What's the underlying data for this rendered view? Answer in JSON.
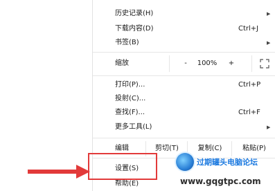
{
  "menu": {
    "items_top": [
      {
        "label": "历史记录(H)",
        "shortcut": "",
        "submenu": true
      },
      {
        "label": "下载内容(D)",
        "shortcut": "Ctrl+J",
        "submenu": false
      },
      {
        "label": "书签(B)",
        "shortcut": "",
        "submenu": true
      }
    ],
    "zoom": {
      "label": "缩放",
      "minus": "-",
      "value": "100%",
      "plus": "+",
      "fullscreen_icon": "fullscreen-icon"
    },
    "items_mid": [
      {
        "label": "打印(P)...",
        "shortcut": "Ctrl+P",
        "submenu": false
      },
      {
        "label": "投射(C)...",
        "shortcut": "",
        "submenu": false
      },
      {
        "label": "查找(F)...",
        "shortcut": "Ctrl+F",
        "submenu": false
      },
      {
        "label": "更多工具(L)",
        "shortcut": "",
        "submenu": true
      }
    ],
    "edit": {
      "label": "编辑",
      "cut": "剪切(T)",
      "copy": "复制(C)",
      "paste": "粘贴(P)"
    },
    "settings_label": "设置(S)",
    "help_label": "帮助(E)",
    "submenu_arrow": "▶"
  },
  "annotation": {
    "highlight_color": "#e23a3a",
    "arrow_color": "#e23a3a"
  },
  "watermark": {
    "title": "过期罐头电脑论坛",
    "url": "www.gqgtpc.com",
    "logo_icon": "forum-logo-icon"
  }
}
